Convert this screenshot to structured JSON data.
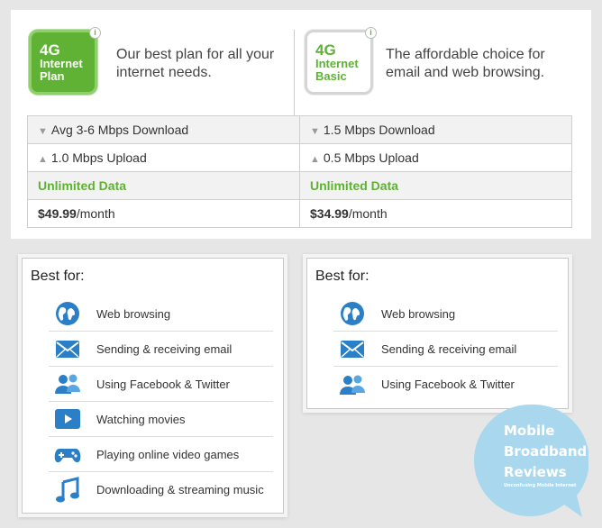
{
  "plans": [
    {
      "badge_4g": "4G",
      "badge_name_1": "Internet",
      "badge_name_2": "Plan",
      "description": "Our best plan for all your internet needs.",
      "download": "Avg 3-6 Mbps Download",
      "upload": "1.0 Mbps Upload",
      "data": "Unlimited Data",
      "price": "$49.99",
      "price_unit": "/month"
    },
    {
      "badge_4g": "4G",
      "badge_name_1": "Internet",
      "badge_name_2": "Basic",
      "description": "The affordable choice for email and web browsing.",
      "download": "1.5 Mbps Download",
      "upload": "0.5 Mbps Upload",
      "data": "Unlimited Data",
      "price": "$34.99",
      "price_unit": "/month"
    }
  ],
  "info_icon_text": "i",
  "best_for": [
    {
      "title": "Best for:",
      "items": [
        {
          "label": "Web browsing",
          "icon": "globe-icon"
        },
        {
          "label": "Sending & receiving email",
          "icon": "envelope-icon"
        },
        {
          "label": "Using Facebook & Twitter",
          "icon": "people-icon"
        },
        {
          "label": "Watching movies",
          "icon": "play-icon"
        },
        {
          "label": "Playing online video games",
          "icon": "gamepad-icon"
        },
        {
          "label": "Downloading & streaming music",
          "icon": "music-note-icon"
        }
      ]
    },
    {
      "title": "Best for:",
      "items": [
        {
          "label": "Web browsing",
          "icon": "globe-icon"
        },
        {
          "label": "Sending & receiving email",
          "icon": "envelope-icon"
        },
        {
          "label": "Using Facebook & Twitter",
          "icon": "people-icon"
        }
      ]
    }
  ],
  "watermark": {
    "line1": "Mobile",
    "line2": "Broadband",
    "line3": "Reviews",
    "tagline": "Unconfusing Mobile Internet"
  },
  "colors": {
    "accent_green": "#5fb233",
    "icon_blue": "#2a7fc6",
    "watermark_blue": "#a9d8ee"
  }
}
